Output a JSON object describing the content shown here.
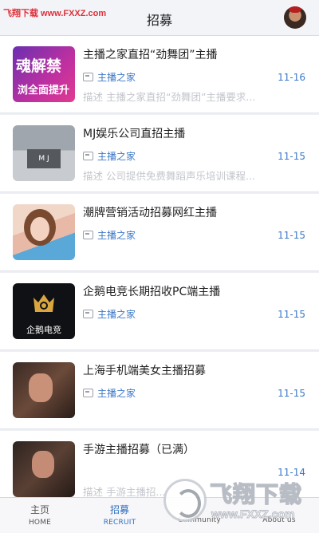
{
  "watermark_top": "飞翔下载 www.FXXZ.com",
  "header": {
    "title": "招募"
  },
  "items": [
    {
      "title": "主播之家直招“劲舞团”主播",
      "tag": "主播之家",
      "date": "11-16",
      "desc": "描述 主播之家直招“劲舞团”主播要求..."
    },
    {
      "title": "MJ娱乐公司直招主播",
      "tag": "主播之家",
      "date": "11-15",
      "desc": "描述 公司提供免费舞蹈声乐培训课程..."
    },
    {
      "title": "潮牌营销活动招募网红主播",
      "tag": "主播之家",
      "date": "11-15",
      "desc": ""
    },
    {
      "title": "企鹅电竞长期招收PC端主播",
      "tag": "主播之家",
      "date": "11-15",
      "desc": ""
    },
    {
      "title": "上海手机端美女主播招募",
      "tag": "主播之家",
      "date": "11-15",
      "desc": ""
    },
    {
      "title": "手游主播招募（已满）",
      "tag": "",
      "date": "11-14",
      "desc": "描述 手游主播招..."
    }
  ],
  "thumbs": {
    "t1_text1": "魂解禁",
    "t1_text2": "浏全面提升",
    "t2_text": "M J",
    "t4_text": "企鹅电竞"
  },
  "tabs": [
    {
      "label": "主页",
      "sub": "HOME"
    },
    {
      "label": "招募",
      "sub": "RECRUIT"
    },
    {
      "label": "",
      "sub": "Community"
    },
    {
      "label": "",
      "sub": "About us"
    }
  ],
  "watermark_bottom": {
    "big": "飞翔下载",
    "url": "www.FXXZ.com"
  },
  "colors": {
    "accent": "#3c78c8",
    "tab_active": "#2f6fc0",
    "watermark_red": "#e0303a"
  }
}
